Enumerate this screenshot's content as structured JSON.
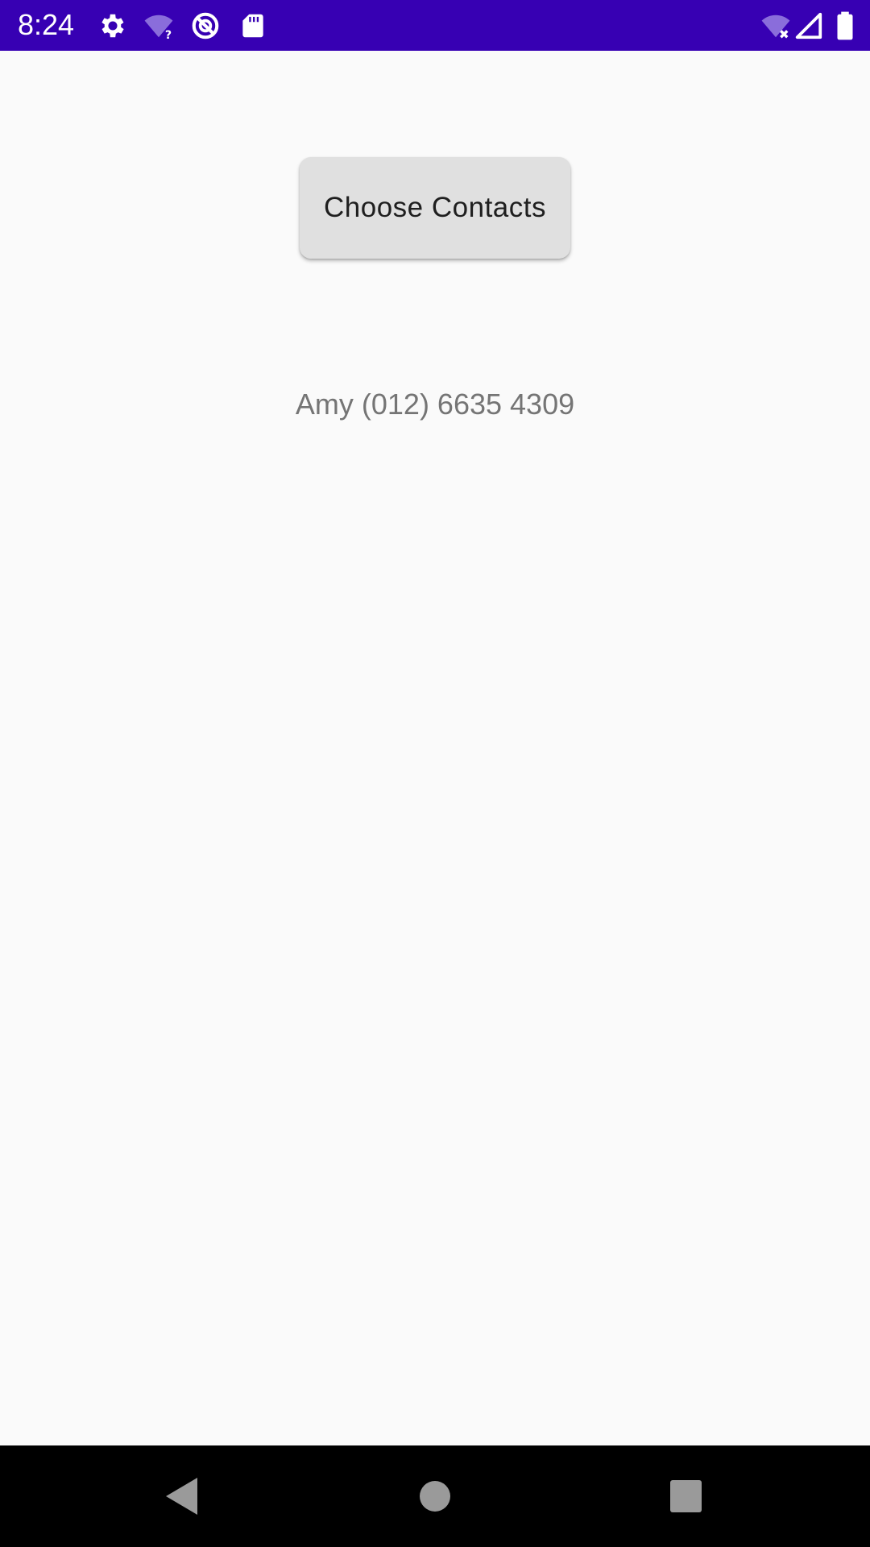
{
  "status_bar": {
    "time": "8:24",
    "background": "#3700b3",
    "left_icons": [
      "gear-icon",
      "wifi-question-icon",
      "circle-slash-icon",
      "sd-card-icon"
    ],
    "right_icons": [
      "wifi-x-icon",
      "cell-signal-icon",
      "battery-icon"
    ]
  },
  "main": {
    "choose_contacts_label": "Choose Contacts",
    "contact_text": "Amy (012) 6635 4309"
  },
  "nav_bar": {
    "buttons": [
      "back-icon",
      "home-icon",
      "recents-icon"
    ]
  }
}
